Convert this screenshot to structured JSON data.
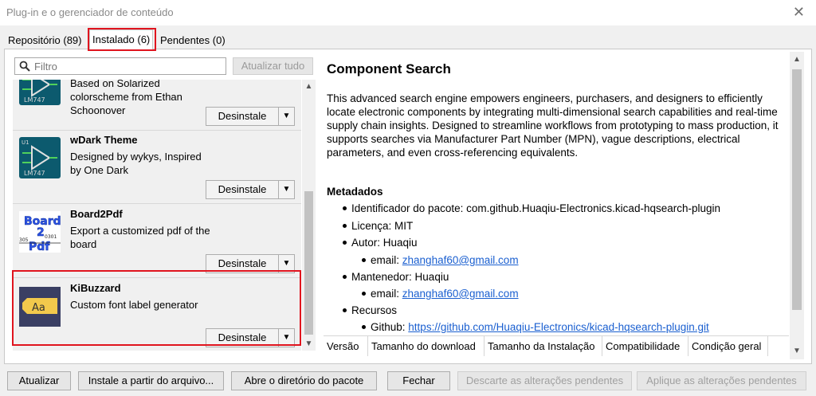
{
  "window": {
    "title": "Plug-in e o gerenciador de conteúdo",
    "close_glyph": "✕"
  },
  "tabs": [
    {
      "label": "Repositório (89)"
    },
    {
      "label": "Instalado (6)"
    },
    {
      "label": "Pendentes (0)"
    }
  ],
  "filter": {
    "placeholder": "Filtro",
    "refresh_label": "Atualizar tudo"
  },
  "packages": [
    {
      "name": "",
      "description": "Based on Solarized colorscheme from Ethan Schoonover",
      "action": "Desinstale",
      "icon": "lm747-chip-icon"
    },
    {
      "name": "wDark Theme",
      "description": "Designed by wykys, Inspired by One Dark",
      "action": "Desinstale",
      "icon": "lm747-chip-icon"
    },
    {
      "name": "Board2Pdf",
      "description": "Export a customized pdf of the board",
      "action": "Desinstale",
      "icon": "board2pdf-icon"
    },
    {
      "name": "KiBuzzard",
      "description": "Custom font label generator",
      "action": "Desinstale",
      "icon": "kibuzzard-icon"
    }
  ],
  "icon_text": {
    "chip_label": "LM747",
    "chip_pin": "U1",
    "board2pdf_lines": [
      "Board",
      "2",
      "Pdf"
    ],
    "board2pdf_numbers": [
      "305",
      "0301"
    ],
    "kibuzzard_text": "Aa"
  },
  "details": {
    "title": "Component Search",
    "description": "This advanced search engine empowers engineers, purchasers, and designers to efficiently locate electronic components by integrating multi-dimensional search capabilities and real-time supply chain insights. Designed to streamline workflows from prototyping to mass production, it supports searches via Manufacturer Part Number (MPN), vague descriptions, electrical parameters, and even cross-referencing equivalents.",
    "metadata_heading": "Metadados",
    "identifier": "Identificador do pacote: com.github.Huaqiu-Electronics.kicad-hqsearch-plugin",
    "license": "Licença: MIT",
    "author": "Autor: Huaqiu",
    "author_email_label": "email:",
    "author_email": "zhanghaf60@gmail.com",
    "maintainer": "Mantenedor: Huaqiu",
    "maintainer_email_label": "email:",
    "maintainer_email": "zhanghaf60@gmail.com",
    "resources": "Recursos",
    "github_label": "Github:",
    "github_url": "https://github.com/Huaqiu-Electronics/kicad-hqsearch-plugin.git"
  },
  "versions_table": {
    "columns": [
      "Versão",
      "Tamanho do download",
      "Tamanho da Instalação",
      "Compatibilidade",
      "Condição geral"
    ]
  },
  "footer": {
    "refresh": "Atualizar",
    "install_from_file": "Instale a partir do arquivo...",
    "open_dir": "Abre o diretório do pacote",
    "close": "Fechar",
    "discard": "Descarte as alterações pendentes",
    "apply": "Aplique as alterações pendentes"
  },
  "colors": {
    "highlight": "#e0141e",
    "link": "#1a5fd0",
    "chip_teal": "#0c5a6e"
  }
}
